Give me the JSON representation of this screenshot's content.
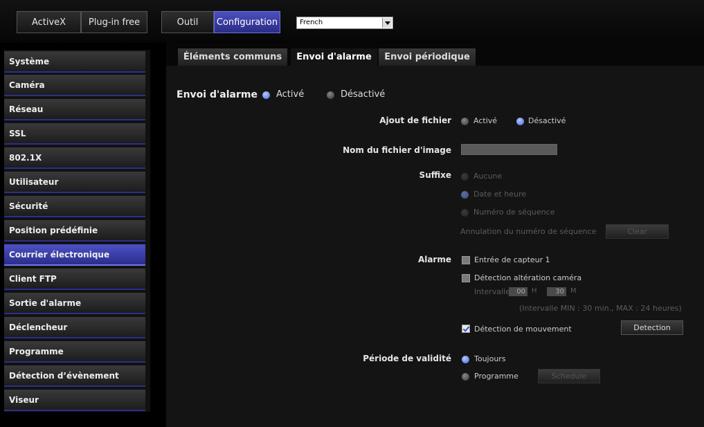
{
  "topbar": {
    "activex": "ActiveX",
    "plugin_free": "Plug-in free",
    "outil": "Outil",
    "configuration": "Configuration",
    "language": "French"
  },
  "sidebar": {
    "items": [
      {
        "label": "Système"
      },
      {
        "label": "Caméra"
      },
      {
        "label": "Réseau"
      },
      {
        "label": "SSL"
      },
      {
        "label": "802.1X"
      },
      {
        "label": "Utilisateur"
      },
      {
        "label": "Sécurité"
      },
      {
        "label": "Position prédéfinie"
      },
      {
        "label": "Courrier électronique"
      },
      {
        "label": "Client FTP"
      },
      {
        "label": "Sortie d'alarme"
      },
      {
        "label": "Déclencheur"
      },
      {
        "label": "Programme"
      },
      {
        "label": "Détection d’évènement"
      },
      {
        "label": "Viseur"
      }
    ],
    "active_index": 8
  },
  "tabs": [
    {
      "label": "Éléments communs"
    },
    {
      "label": "Envoi d'alarme"
    },
    {
      "label": "Envoi périodique"
    }
  ],
  "active_tab": 1,
  "form": {
    "envoi_alarme": {
      "label": "Envoi d'alarme",
      "active": "Activé",
      "inactive": "Désactivé",
      "value": "Activé"
    },
    "ajout_fichier": {
      "label": "Ajout de fichier",
      "active": "Activé",
      "inactive": "Désactivé",
      "value": "Désactivé"
    },
    "nom_fichier": {
      "label": "Nom du fichier d'image",
      "value": ""
    },
    "suffixe": {
      "label": "Suffixe",
      "options": [
        "Aucune",
        "Date et heure",
        "Numéro de séquence"
      ],
      "value": "Date et heure"
    },
    "annulation": {
      "label": "Annulation du numéro de séquence",
      "button": "Clear"
    },
    "alarme": {
      "label": "Alarme",
      "capteur": {
        "label": "Entrée de capteur 1",
        "checked": false
      },
      "alteration": {
        "label": "Détection altération caméra",
        "checked": false
      },
      "intervalle_label": "Intervalle",
      "hours": "00",
      "h_unit": "H",
      "minutes": "30",
      "m_unit": "M",
      "intervalle_note": "(Intervalle MIN : 30 min., MAX : 24 heures)",
      "mouvement": {
        "label": "Détection de mouvement",
        "checked": true
      },
      "detection_button": "Detection"
    },
    "periode": {
      "label": "Période de validité",
      "toujours": "Toujours",
      "programme": "Programme",
      "schedule_button": "Schedule",
      "value": "Toujours"
    }
  },
  "colors": {
    "accent": "#3e44b0",
    "radio_on": "#4a72e0",
    "background": "#141414"
  }
}
